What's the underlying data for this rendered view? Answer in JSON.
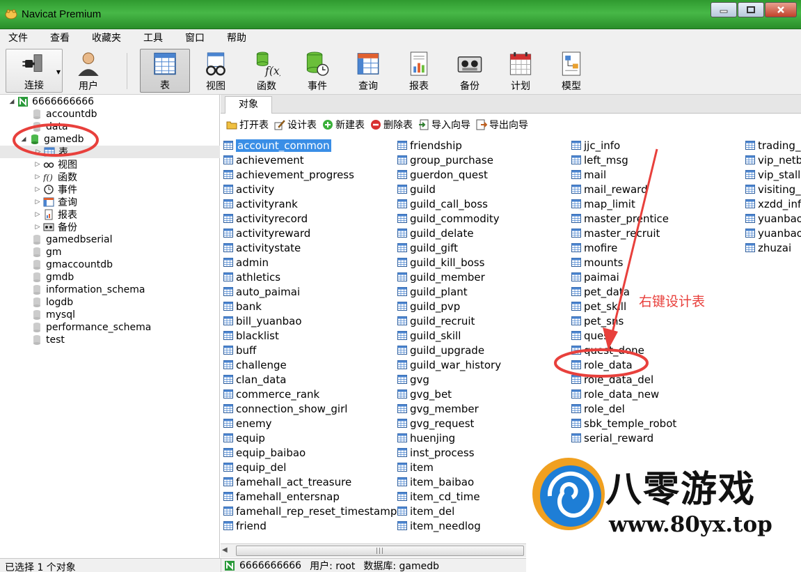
{
  "window": {
    "title": "Navicat Premium"
  },
  "menu": [
    "文件",
    "查看",
    "收藏夹",
    "工具",
    "窗口",
    "帮助"
  ],
  "toolbar": {
    "connect": "连接",
    "user": "用户",
    "table": "表",
    "view": "视图",
    "function": "函数",
    "event": "事件",
    "query": "查询",
    "report": "报表",
    "backup": "备份",
    "schedule": "计划",
    "model": "模型"
  },
  "tree": {
    "connection": "6666666666",
    "dbs_before": [
      "accountdb",
      "data"
    ],
    "active_db": "gamedb",
    "children": [
      "表",
      "视图",
      "函数",
      "事件",
      "查询",
      "报表",
      "备份"
    ],
    "dbs_after": [
      "gamedbserial",
      "gm",
      "gmaccountdb",
      "gmdb",
      "information_schema",
      "logdb",
      "mysql",
      "performance_schema",
      "test"
    ]
  },
  "tab": {
    "label": "对象"
  },
  "objbar": {
    "open": "打开表",
    "design": "设计表",
    "new": "新建表",
    "delete": "删除表",
    "import": "导入向导",
    "export": "导出向导"
  },
  "tables": {
    "col1": [
      "account_common",
      "achievement",
      "achievement_progress",
      "activity",
      "activityrank",
      "activityrecord",
      "activityreward",
      "activitystate",
      "admin",
      "athletics",
      "auto_paimai",
      "bank",
      "bill_yuanbao",
      "blacklist",
      "buff",
      "challenge",
      "clan_data",
      "commerce_rank",
      "connection_show_girl",
      "enemy",
      "equip",
      "equip_baibao",
      "equip_del",
      "famehall_act_treasure",
      "famehall_entersnap",
      "famehall_rep_reset_timestamp",
      "friend"
    ],
    "col2": [
      "friendship",
      "group_purchase",
      "guerdon_quest",
      "guild",
      "guild_call_boss",
      "guild_commodity",
      "guild_delate",
      "guild_gift",
      "guild_kill_boss",
      "guild_member",
      "guild_plant",
      "guild_pvp",
      "guild_recruit",
      "guild_skill",
      "guild_upgrade",
      "guild_war_history",
      "gvg",
      "gvg_bet",
      "gvg_member",
      "gvg_request",
      "huenjing",
      "inst_process",
      "item",
      "item_baibao",
      "item_cd_time",
      "item_del",
      "item_needlog"
    ],
    "col3": [
      "jjc_info",
      "left_msg",
      "mail",
      "mail_reward",
      "map_limit",
      "master_prentice",
      "master_recruit",
      "mofire",
      "mounts",
      "paimai",
      "pet_data",
      "pet_skill",
      "pet_sns",
      "quest",
      "quest_done",
      "role_data",
      "role_data_del",
      "role_data_new",
      "role_del",
      "sbk_temple_robot",
      "serial_reward"
    ],
    "col4": [
      "trading_i",
      "vip_netb",
      "vip_stall",
      "visiting_c",
      "xzdd_info",
      "yuanbao",
      "yuanbao",
      "zhuzai"
    ]
  },
  "status": {
    "left": "已选择 1 个对象",
    "connection": "6666666666",
    "user": "用户: root",
    "database": "数据库: gamedb"
  },
  "annotation": {
    "text": "右键设计表"
  },
  "watermark": {
    "brand": "八零游戏",
    "url": "www.80yx.top"
  },
  "colors": {
    "title_green": "#3aa83a",
    "selection": "#3a8ee6",
    "annotation_red": "#e8403c"
  }
}
